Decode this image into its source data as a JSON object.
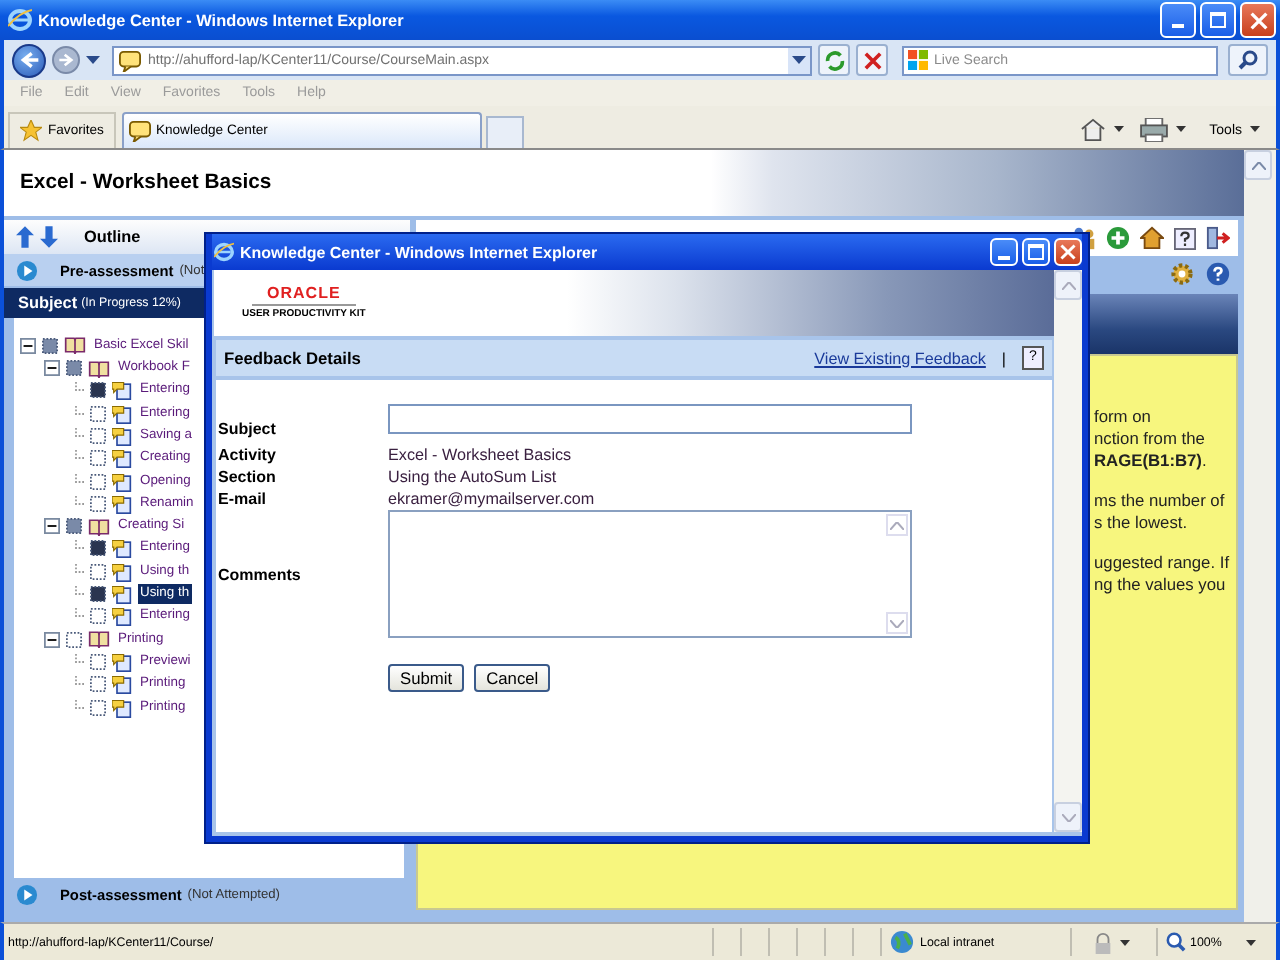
{
  "browser": {
    "title": "Knowledge Center - Windows Internet Explorer",
    "address": "http://ahufford-lap/KCenter11/Course/CourseMain.aspx",
    "search": {
      "placeholder": "Live Search"
    },
    "menu": [
      "File",
      "Edit",
      "View",
      "Favorites",
      "Tools",
      "Help"
    ],
    "favorites_button": "Favorites",
    "tabs": [
      {
        "label": "Knowledge Center",
        "selected": true
      }
    ],
    "tools_button": "Tools"
  },
  "page": {
    "title": "Excel - Worksheet Basics",
    "outline": {
      "label": "Outline"
    },
    "pre_assessment": {
      "label": "Pre-assessment",
      "status": "(Not"
    },
    "subject": {
      "label": "Subject",
      "status": "(In Progress 12%)"
    },
    "tree": [
      {
        "label": "Basic Excel Skil",
        "started": true,
        "expanded": true,
        "selected": false,
        "children": [
          {
            "label": "Workbook F",
            "started": true,
            "expanded": true,
            "selected": false,
            "children": [
              {
                "label": "Entering",
                "completed": true,
                "selected": false
              },
              {
                "label": "Entering",
                "completed": false,
                "selected": false
              },
              {
                "label": "Saving a",
                "completed": false,
                "selected": false
              },
              {
                "label": "Creating",
                "completed": false,
                "selected": false
              },
              {
                "label": "Opening",
                "completed": false,
                "selected": false
              },
              {
                "label": "Renamin",
                "completed": false,
                "selected": false
              }
            ]
          },
          {
            "label": "Creating Si",
            "started": true,
            "expanded": true,
            "selected": false,
            "children": [
              {
                "label": "Entering",
                "completed": true,
                "selected": false
              },
              {
                "label": "Using th",
                "completed": false,
                "selected": false
              },
              {
                "label": "Using th",
                "completed": true,
                "selected": true
              },
              {
                "label": "Entering",
                "completed": false,
                "selected": false
              }
            ]
          },
          {
            "label": "Printing",
            "started": false,
            "expanded": true,
            "selected": false,
            "children": [
              {
                "label": "Previewi",
                "completed": false,
                "selected": false
              },
              {
                "label": "Printing",
                "completed": false,
                "selected": false
              },
              {
                "label": "Printing",
                "completed": false,
                "selected": false
              }
            ]
          }
        ]
      }
    ],
    "post_assessment": {
      "label": "Post-assessment",
      "status": "(Not Attempted)"
    },
    "content": [
      [
        "form on",
        "nction from the",
        "**RAGE(B1:B7)**."
      ],
      [
        "ms the number of",
        "s the lowest."
      ],
      [
        "uggested range. If",
        "ng the values you"
      ]
    ]
  },
  "dialog": {
    "title": "Knowledge Center - Windows Internet Explorer",
    "logo": "ORACLE",
    "logo_sub": "USER PRODUCTIVITY KIT",
    "header": "Feedback Details",
    "link": "View Existing Feedback",
    "separator": "|",
    "help": "?",
    "fields": [
      {
        "label": "Subject",
        "kind": "input"
      },
      {
        "label": "Activity",
        "kind": "text",
        "value": "Excel - Worksheet Basics"
      },
      {
        "label": "Section",
        "kind": "text",
        "value": "Using the AutoSum List"
      },
      {
        "label": "E-mail",
        "kind": "text",
        "value": "ekramer@mymailserver.com"
      },
      {
        "label": "Comments",
        "kind": "textarea"
      }
    ],
    "buttons": [
      "Submit",
      "Cancel"
    ]
  },
  "status_bar": {
    "url": "http://ahufford-lap/KCenter11/Course/",
    "zone": "Local intranet",
    "zoom": "100%"
  }
}
